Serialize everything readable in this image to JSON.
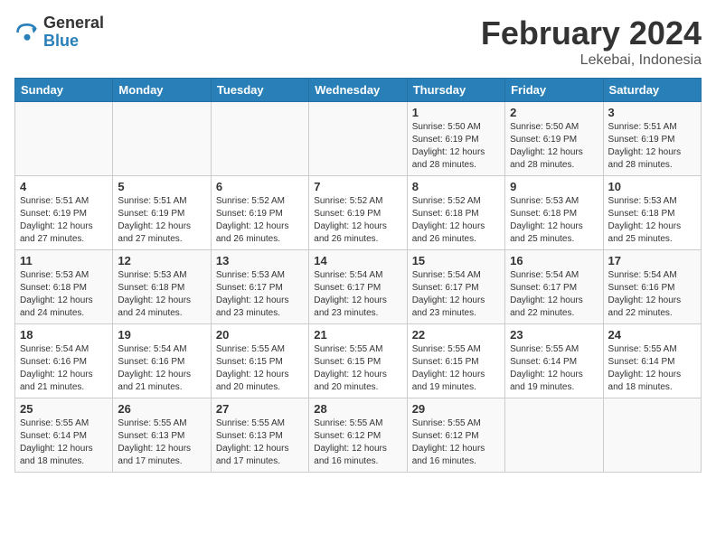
{
  "header": {
    "logo_general": "General",
    "logo_blue": "Blue",
    "month_year": "February 2024",
    "location": "Lekebai, Indonesia"
  },
  "days_of_week": [
    "Sunday",
    "Monday",
    "Tuesday",
    "Wednesday",
    "Thursday",
    "Friday",
    "Saturday"
  ],
  "weeks": [
    [
      {
        "day": "",
        "info": ""
      },
      {
        "day": "",
        "info": ""
      },
      {
        "day": "",
        "info": ""
      },
      {
        "day": "",
        "info": ""
      },
      {
        "day": "1",
        "info": "Sunrise: 5:50 AM\nSunset: 6:19 PM\nDaylight: 12 hours\nand 28 minutes."
      },
      {
        "day": "2",
        "info": "Sunrise: 5:50 AM\nSunset: 6:19 PM\nDaylight: 12 hours\nand 28 minutes."
      },
      {
        "day": "3",
        "info": "Sunrise: 5:51 AM\nSunset: 6:19 PM\nDaylight: 12 hours\nand 28 minutes."
      }
    ],
    [
      {
        "day": "4",
        "info": "Sunrise: 5:51 AM\nSunset: 6:19 PM\nDaylight: 12 hours\nand 27 minutes."
      },
      {
        "day": "5",
        "info": "Sunrise: 5:51 AM\nSunset: 6:19 PM\nDaylight: 12 hours\nand 27 minutes."
      },
      {
        "day": "6",
        "info": "Sunrise: 5:52 AM\nSunset: 6:19 PM\nDaylight: 12 hours\nand 26 minutes."
      },
      {
        "day": "7",
        "info": "Sunrise: 5:52 AM\nSunset: 6:19 PM\nDaylight: 12 hours\nand 26 minutes."
      },
      {
        "day": "8",
        "info": "Sunrise: 5:52 AM\nSunset: 6:18 PM\nDaylight: 12 hours\nand 26 minutes."
      },
      {
        "day": "9",
        "info": "Sunrise: 5:53 AM\nSunset: 6:18 PM\nDaylight: 12 hours\nand 25 minutes."
      },
      {
        "day": "10",
        "info": "Sunrise: 5:53 AM\nSunset: 6:18 PM\nDaylight: 12 hours\nand 25 minutes."
      }
    ],
    [
      {
        "day": "11",
        "info": "Sunrise: 5:53 AM\nSunset: 6:18 PM\nDaylight: 12 hours\nand 24 minutes."
      },
      {
        "day": "12",
        "info": "Sunrise: 5:53 AM\nSunset: 6:18 PM\nDaylight: 12 hours\nand 24 minutes."
      },
      {
        "day": "13",
        "info": "Sunrise: 5:53 AM\nSunset: 6:17 PM\nDaylight: 12 hours\nand 23 minutes."
      },
      {
        "day": "14",
        "info": "Sunrise: 5:54 AM\nSunset: 6:17 PM\nDaylight: 12 hours\nand 23 minutes."
      },
      {
        "day": "15",
        "info": "Sunrise: 5:54 AM\nSunset: 6:17 PM\nDaylight: 12 hours\nand 23 minutes."
      },
      {
        "day": "16",
        "info": "Sunrise: 5:54 AM\nSunset: 6:17 PM\nDaylight: 12 hours\nand 22 minutes."
      },
      {
        "day": "17",
        "info": "Sunrise: 5:54 AM\nSunset: 6:16 PM\nDaylight: 12 hours\nand 22 minutes."
      }
    ],
    [
      {
        "day": "18",
        "info": "Sunrise: 5:54 AM\nSunset: 6:16 PM\nDaylight: 12 hours\nand 21 minutes."
      },
      {
        "day": "19",
        "info": "Sunrise: 5:54 AM\nSunset: 6:16 PM\nDaylight: 12 hours\nand 21 minutes."
      },
      {
        "day": "20",
        "info": "Sunrise: 5:55 AM\nSunset: 6:15 PM\nDaylight: 12 hours\nand 20 minutes."
      },
      {
        "day": "21",
        "info": "Sunrise: 5:55 AM\nSunset: 6:15 PM\nDaylight: 12 hours\nand 20 minutes."
      },
      {
        "day": "22",
        "info": "Sunrise: 5:55 AM\nSunset: 6:15 PM\nDaylight: 12 hours\nand 19 minutes."
      },
      {
        "day": "23",
        "info": "Sunrise: 5:55 AM\nSunset: 6:14 PM\nDaylight: 12 hours\nand 19 minutes."
      },
      {
        "day": "24",
        "info": "Sunrise: 5:55 AM\nSunset: 6:14 PM\nDaylight: 12 hours\nand 18 minutes."
      }
    ],
    [
      {
        "day": "25",
        "info": "Sunrise: 5:55 AM\nSunset: 6:14 PM\nDaylight: 12 hours\nand 18 minutes."
      },
      {
        "day": "26",
        "info": "Sunrise: 5:55 AM\nSunset: 6:13 PM\nDaylight: 12 hours\nand 17 minutes."
      },
      {
        "day": "27",
        "info": "Sunrise: 5:55 AM\nSunset: 6:13 PM\nDaylight: 12 hours\nand 17 minutes."
      },
      {
        "day": "28",
        "info": "Sunrise: 5:55 AM\nSunset: 6:12 PM\nDaylight: 12 hours\nand 16 minutes."
      },
      {
        "day": "29",
        "info": "Sunrise: 5:55 AM\nSunset: 6:12 PM\nDaylight: 12 hours\nand 16 minutes."
      },
      {
        "day": "",
        "info": ""
      },
      {
        "day": "",
        "info": ""
      }
    ]
  ]
}
